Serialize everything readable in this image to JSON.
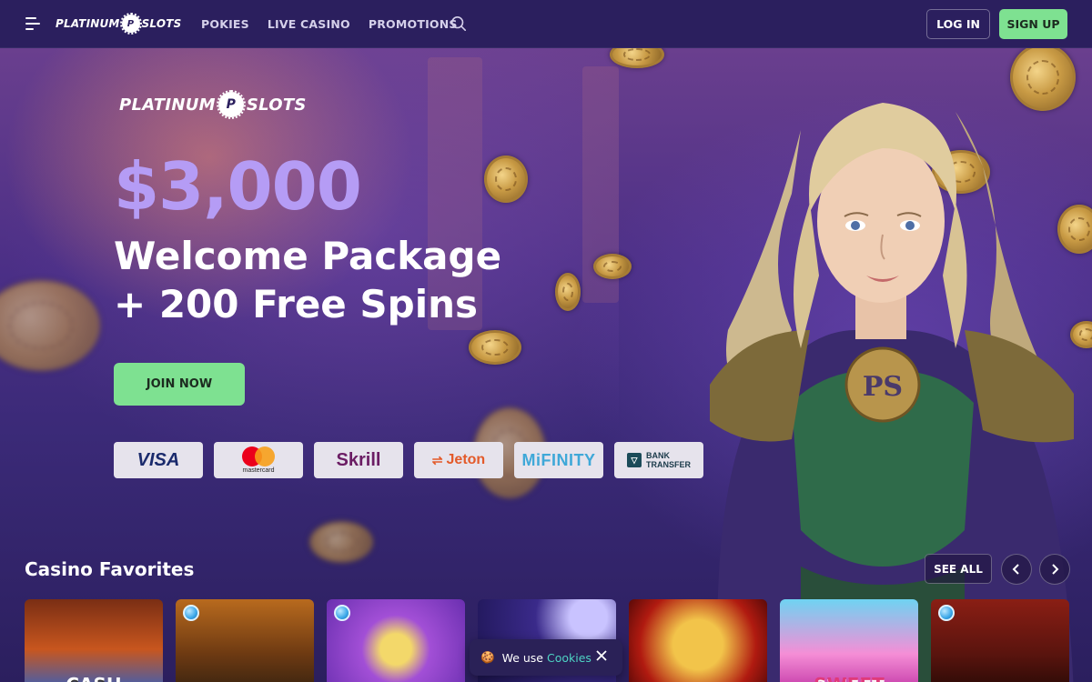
{
  "brand": {
    "name_left": "PLATINUM",
    "badge": "P",
    "name_right": "SLOTS"
  },
  "header": {
    "nav": [
      "POKIES",
      "LIVE CASINO",
      "PROMOTIONS"
    ],
    "login_label": "LOG IN",
    "signup_label": "SIGN UP"
  },
  "hero": {
    "amount": "$3,000",
    "headline_line1": "Welcome Package",
    "headline_line2": "+ 200 Free Spins",
    "cta_label": "JOIN NOW"
  },
  "payments": {
    "visa": "VISA",
    "mastercard": "mastercard",
    "skrill": "Skrill",
    "jeton": "Jeton",
    "mifinity": "MiFINITY",
    "bank_line1": "BANK",
    "bank_line2": "TRANSFER"
  },
  "favorites": {
    "title": "Casino Favorites",
    "see_all_label": "SEE ALL",
    "games": [
      {
        "label": "CASH",
        "has_gem": false
      },
      {
        "label": "",
        "has_gem": true
      },
      {
        "label": "",
        "has_gem": true
      },
      {
        "label": "",
        "has_gem": false
      },
      {
        "label": "",
        "has_gem": false
      },
      {
        "label": "SWEET",
        "has_gem": false
      },
      {
        "label": "",
        "has_gem": true
      }
    ]
  },
  "cookie": {
    "prefix": "We use",
    "link": "Cookies"
  },
  "colors": {
    "header_bg": "#2b1f5e",
    "accent_green": "#7ee191",
    "amount_purple": "#b59cf5",
    "cookie_link": "#4ed3c4"
  }
}
